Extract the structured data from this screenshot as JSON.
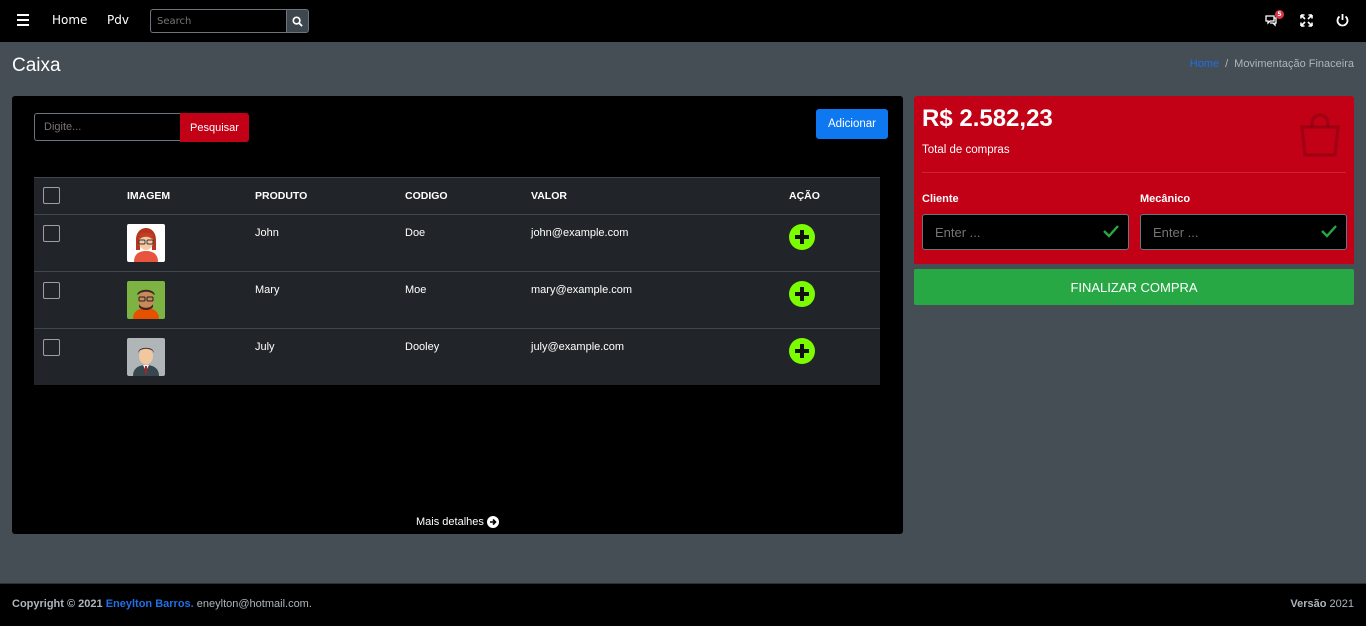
{
  "navbar": {
    "home_label": "Home",
    "pdv_label": "Pdv",
    "search_placeholder": "Search",
    "notification_count": "5"
  },
  "header": {
    "title": "Caixa",
    "breadcrumb_home": "Home",
    "breadcrumb_separator": "/",
    "breadcrumb_current": "Movimentação Finaceira"
  },
  "main": {
    "filter_placeholder": "Digite...",
    "filter_button": "Pesquisar",
    "add_button": "Adicionar",
    "table": {
      "columns": [
        "IMAGEM",
        "PRODUTO",
        "CODIGO",
        "VALOR",
        "AÇÃO"
      ],
      "rows": [
        {
          "produto": "John",
          "codigo": "Doe",
          "valor": "john@example.com",
          "avatar": "female-red-hair-glasses"
        },
        {
          "produto": "Mary",
          "codigo": "Moe",
          "valor": "mary@example.com",
          "avatar": "male-glasses-beard"
        },
        {
          "produto": "July",
          "codigo": "Dooley",
          "valor": "july@example.com",
          "avatar": "male-suit"
        }
      ]
    },
    "more_details": "Mais detalhes"
  },
  "summary": {
    "total": "R$ 2.582,23",
    "total_label": "Total de compras",
    "cliente_label": "Cliente",
    "mecanico_label": "Mecânico",
    "input_placeholder": "Enter ...",
    "finish_button": "FINALIZAR COMPRA"
  },
  "footer": {
    "copyright": "Copyright © 2021",
    "author": "Eneylton Barros.",
    "email": "eneylton@hotmail.com.",
    "version_label": "Versão",
    "version": "2021"
  },
  "colors": {
    "navbar_bg": "#000000",
    "page_bg": "#454d55",
    "danger": "#c20016",
    "primary": "#0d78f0",
    "success": "#28a745",
    "action_green": "#7cfc00"
  }
}
